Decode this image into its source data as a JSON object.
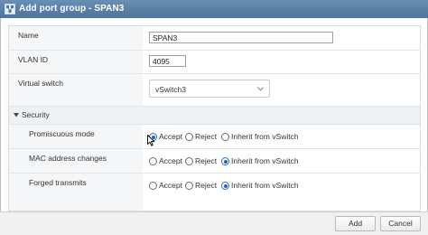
{
  "window": {
    "title": "Add port group - SPAN3"
  },
  "form": {
    "name": {
      "label": "Name",
      "value": "SPAN3"
    },
    "vlan_id": {
      "label": "VLAN ID",
      "value": "4095"
    },
    "virtual_switch": {
      "label": "Virtual switch",
      "selected": "vSwitch3"
    },
    "security": {
      "label": "Security",
      "expanded": true,
      "rows": [
        {
          "label": "Promiscuous mode",
          "options": [
            "Accept",
            "Reject",
            "Inherit from vSwitch"
          ],
          "selected": "Accept"
        },
        {
          "label": "MAC address changes",
          "options": [
            "Accept",
            "Reject",
            "Inherit from vSwitch"
          ],
          "selected": "Inherit from vSwitch"
        },
        {
          "label": "Forged transmits",
          "options": [
            "Accept",
            "Reject",
            "Inherit from vSwitch"
          ],
          "selected": "Inherit from vSwitch"
        }
      ]
    }
  },
  "footer": {
    "add_label": "Add",
    "cancel_label": "Cancel"
  },
  "icons": {
    "title_icon": "network-icon",
    "cursor": "mouse-pointer-icon"
  },
  "colors": {
    "titlebar": "#5a7ea6",
    "radio_selected": "#1a63c9",
    "label_background": "#f4f6f8"
  }
}
